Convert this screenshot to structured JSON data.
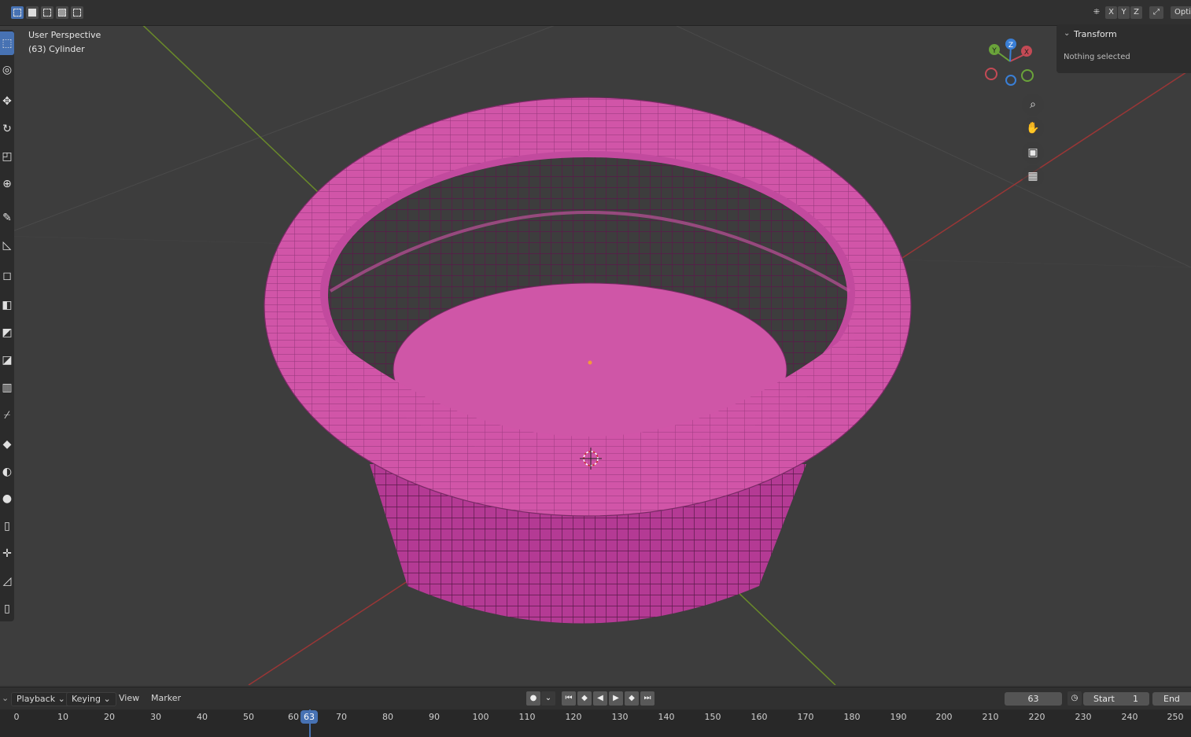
{
  "header": {
    "select_modes": [
      "select-box-new-icon",
      "select-box-extend-icon",
      "select-box-subtract-icon",
      "select-box-invert-icon",
      "select-box-intersect-icon"
    ],
    "mirror_axes": [
      "X",
      "Y",
      "Z"
    ],
    "options_label": "Opti"
  },
  "viewport": {
    "view_name": "User Perspective",
    "object_info": "(63) Cylinder",
    "gizmo": {
      "x": "X",
      "y": "Y",
      "z": "Z"
    },
    "object_color": "#d155a8"
  },
  "toolbar": {
    "tools": [
      "select-box-icon",
      "cursor-icon",
      "move-icon",
      "rotate-icon",
      "scale-icon",
      "transform-icon",
      "annotate-icon",
      "measure-icon",
      "add-cube-icon",
      "extrude-icon",
      "inset-icon",
      "bevel-icon",
      "loop-cut-icon",
      "knife-icon",
      "poly-build-icon",
      "spin-icon",
      "smooth-icon",
      "edge-slide-icon",
      "shrink-fatten-icon",
      "shear-icon",
      "rip-icon"
    ]
  },
  "npanel": {
    "section_title": "Transform",
    "empty_text": "Nothing selected"
  },
  "timeline": {
    "menus": {
      "playback": "Playback",
      "keying": "Keying",
      "view": "View",
      "marker": "Marker"
    },
    "current_frame": "63",
    "start_label": "Start",
    "start_value": "1",
    "end_label": "End",
    "ruler_ticks": [
      "0",
      "10",
      "20",
      "30",
      "40",
      "50",
      "60",
      "70",
      "80",
      "90",
      "100",
      "110",
      "120",
      "130",
      "140",
      "150",
      "160",
      "170",
      "180",
      "190",
      "200",
      "210",
      "220",
      "230",
      "240",
      "250"
    ]
  }
}
